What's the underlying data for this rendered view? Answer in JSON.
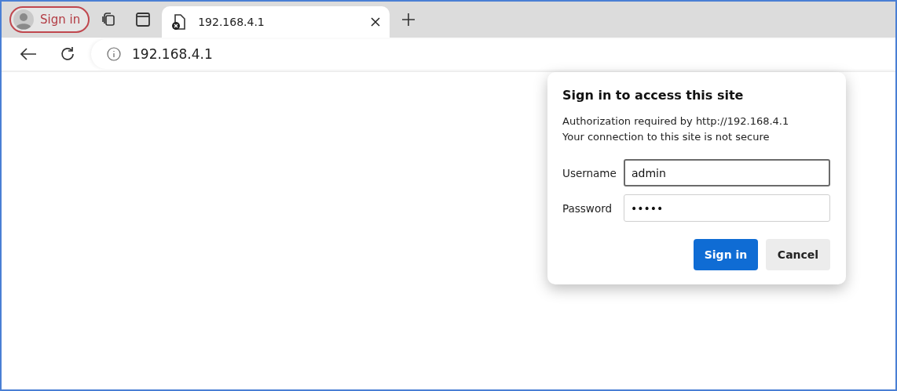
{
  "profile": {
    "label": "Sign in"
  },
  "tabs": [
    {
      "title": "192.168.4.1",
      "selected": true
    }
  ],
  "address_bar": {
    "url": "192.168.4.1"
  },
  "dialog": {
    "title": "Sign in to access this site",
    "lines": [
      "Authorization required by http://192.168.4.1",
      "Your connection to this site is not secure"
    ],
    "fields": [
      {
        "label": "Username",
        "value": "admin",
        "focused": true
      },
      {
        "label": "Password",
        "value": "•••••",
        "focused": false
      }
    ],
    "buttons": [
      {
        "label": "Sign in",
        "kind": "primary"
      },
      {
        "label": "Cancel",
        "kind": "secondary"
      }
    ]
  }
}
